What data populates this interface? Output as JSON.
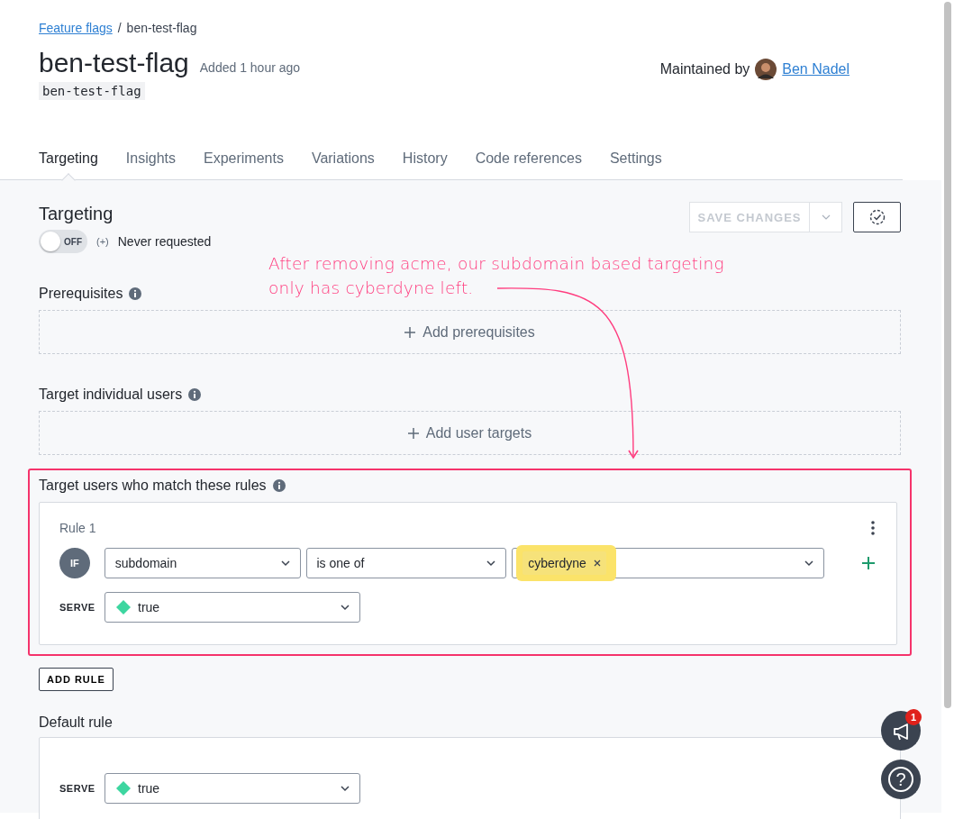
{
  "breadcrumb": {
    "link": "Feature flags",
    "separator": "/",
    "current": "ben-test-flag"
  },
  "flag": {
    "title": "ben-test-flag",
    "added": "Added 1 hour ago",
    "key": "ben-test-flag"
  },
  "maintainer": {
    "label": "Maintained by",
    "name": "Ben Nadel"
  },
  "tabs": [
    {
      "label": "Targeting",
      "selected": true
    },
    {
      "label": "Insights",
      "selected": false
    },
    {
      "label": "Experiments",
      "selected": false
    },
    {
      "label": "Variations",
      "selected": false
    },
    {
      "label": "History",
      "selected": false
    },
    {
      "label": "Code references",
      "selected": false
    },
    {
      "label": "Settings",
      "selected": false
    }
  ],
  "targeting": {
    "title": "Targeting",
    "toggle": {
      "on": false,
      "label": "OFF"
    },
    "status_mark": "(+)",
    "status": "Never requested",
    "save_button": {
      "label": "SAVE CHANGES",
      "disabled": true
    }
  },
  "prerequisites": {
    "title": "Prerequisites",
    "add": "Add prerequisites"
  },
  "individual_targets": {
    "title": "Target individual users",
    "add": "Add user targets"
  },
  "rules_section": {
    "title": "Target users who match these rules",
    "highlighted": true,
    "rules": [
      {
        "label": "Rule 1",
        "if": "IF",
        "attribute": "subdomain",
        "operator": "is one of",
        "values": [
          {
            "label": "cyberdyne",
            "highlighted": true
          }
        ],
        "serve_label": "SERVE",
        "serve": "true"
      }
    ]
  },
  "add_rule": "ADD RULE",
  "default_rule": {
    "title": "Default rule",
    "serve_label": "SERVE",
    "serve": "true"
  },
  "annotation": {
    "text": "After removing acme, our subdomain based targeting\nonly has cyberdyne left."
  },
  "notifications": {
    "badge": "1"
  },
  "help": "?"
}
